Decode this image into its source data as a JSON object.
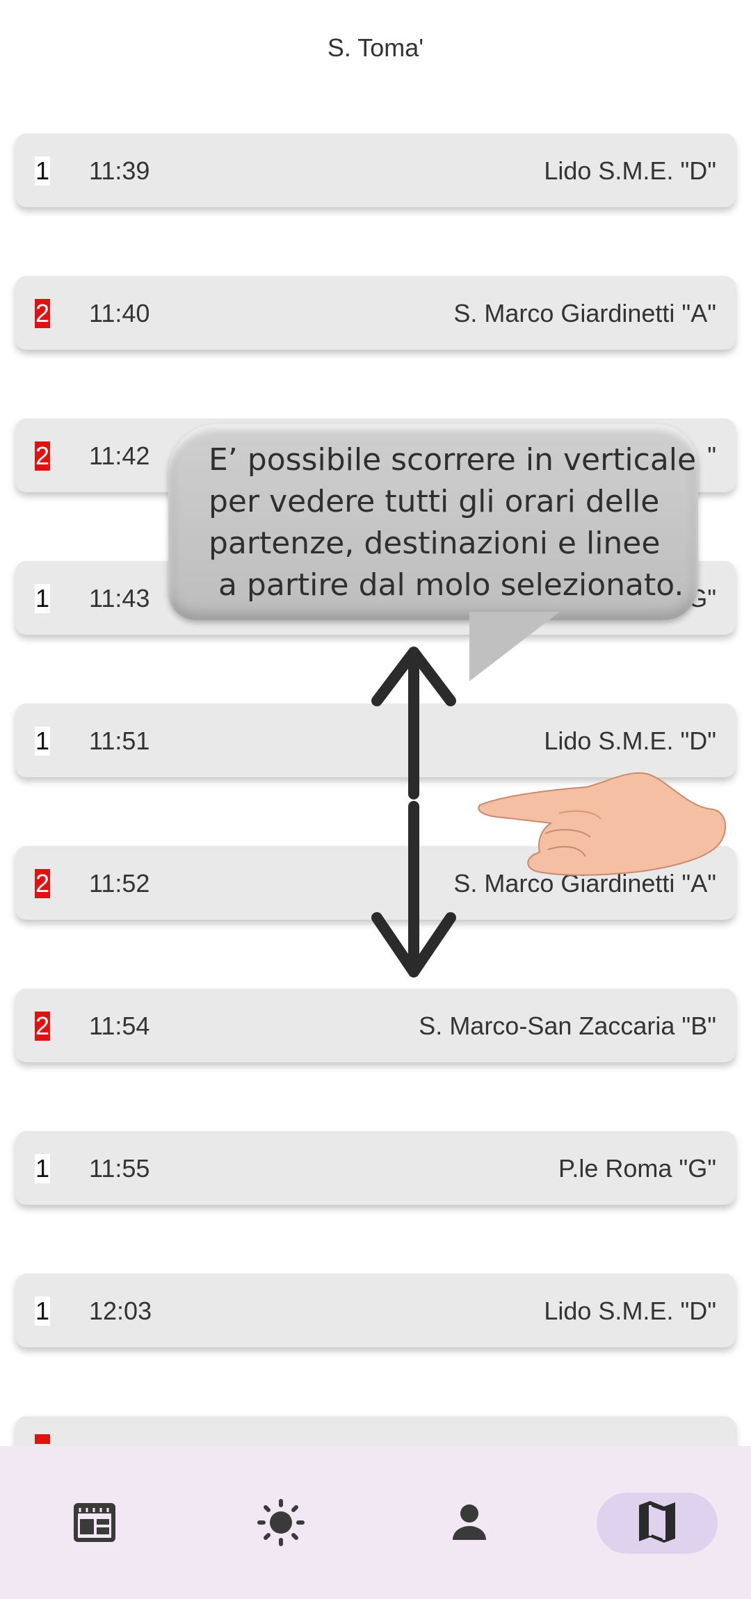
{
  "header": {
    "title": "S. Toma'"
  },
  "departures": [
    {
      "line": "1",
      "line_color": "white",
      "time": "11:39",
      "destination": "Lido S.M.E. \"D\""
    },
    {
      "line": "2",
      "line_color": "red",
      "time": "11:40",
      "destination": "S. Marco Giardinetti \"A\""
    },
    {
      "line": "2",
      "line_color": "red",
      "time": "11:42",
      "destination": "\""
    },
    {
      "line": "1",
      "line_color": "white",
      "time": "11:43",
      "destination": "G\""
    },
    {
      "line": "1",
      "line_color": "white",
      "time": "11:51",
      "destination": "Lido S.M.E. \"D\""
    },
    {
      "line": "2",
      "line_color": "red",
      "time": "11:52",
      "destination": "S. Marco Giardinetti \"A\""
    },
    {
      "line": "2",
      "line_color": "red",
      "time": "11:54",
      "destination": "S. Marco-San Zaccaria \"B\""
    },
    {
      "line": "1",
      "line_color": "white",
      "time": "11:55",
      "destination": "P.le Roma \"G\""
    },
    {
      "line": "1",
      "line_color": "white",
      "time": "12:03",
      "destination": "Lido S.M.E. \"D\""
    }
  ],
  "tutorial": {
    "text": "E’ possibile scorrere in verticale\nper vedere tutti gli orari delle\npartenze, destinazioni e linee\n a partire dal molo selezionato."
  },
  "nav": {
    "items": [
      "timetable-icon",
      "weather-icon",
      "profile-icon",
      "map-icon"
    ],
    "active": "map-icon"
  },
  "colors": {
    "line2": "#e31010",
    "nav_bg": "#f1e8f4",
    "nav_active": "#dfd2ee"
  }
}
